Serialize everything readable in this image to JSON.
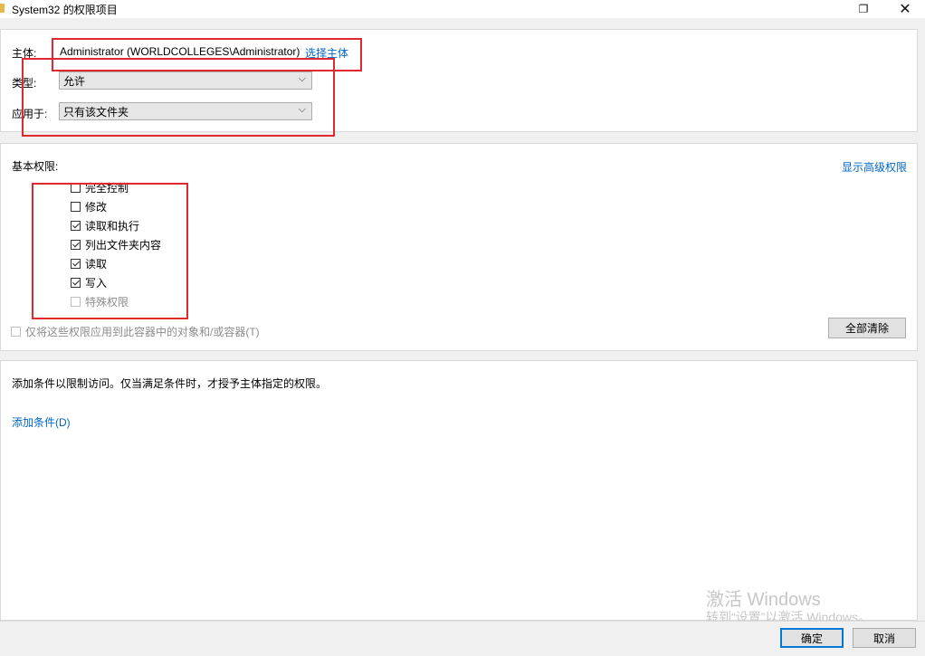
{
  "window": {
    "title": "System32 的权限项目",
    "restore_glyph": "❐",
    "close_glyph": "✕"
  },
  "principal": {
    "label": "主体:",
    "value": "Administrator (WORLDCOLLEGES\\Administrator)",
    "select_link": "选择主体"
  },
  "type": {
    "label": "类型:",
    "value": "允许"
  },
  "applies_to": {
    "label": "应用于:",
    "value": "只有该文件夹"
  },
  "permissions": {
    "heading": "基本权限:",
    "show_advanced": "显示高级权限",
    "items": [
      {
        "label": "完全控制",
        "checked": false,
        "disabled": false
      },
      {
        "label": "修改",
        "checked": false,
        "disabled": false
      },
      {
        "label": "读取和执行",
        "checked": true,
        "disabled": false
      },
      {
        "label": "列出文件夹内容",
        "checked": true,
        "disabled": false
      },
      {
        "label": "读取",
        "checked": true,
        "disabled": false
      },
      {
        "label": "写入",
        "checked": true,
        "disabled": false
      },
      {
        "label": "特殊权限",
        "checked": false,
        "disabled": true
      }
    ],
    "apply_only": "仅将这些权限应用到此容器中的对象和/或容器(T)",
    "clear_all": "全部清除"
  },
  "conditions": {
    "description": "添加条件以限制访问。仅当满足条件时，才授予主体指定的权限。",
    "add_link": "添加条件(D)"
  },
  "buttons": {
    "ok": "确定",
    "cancel": "取消"
  },
  "watermark": {
    "line1": "激活 Windows",
    "line2": "转到“设置”以激活 Windows。"
  },
  "colors": {
    "link": "#0066cc",
    "highlight_box": "#e0282e",
    "default_button_border": "#0078d7"
  }
}
